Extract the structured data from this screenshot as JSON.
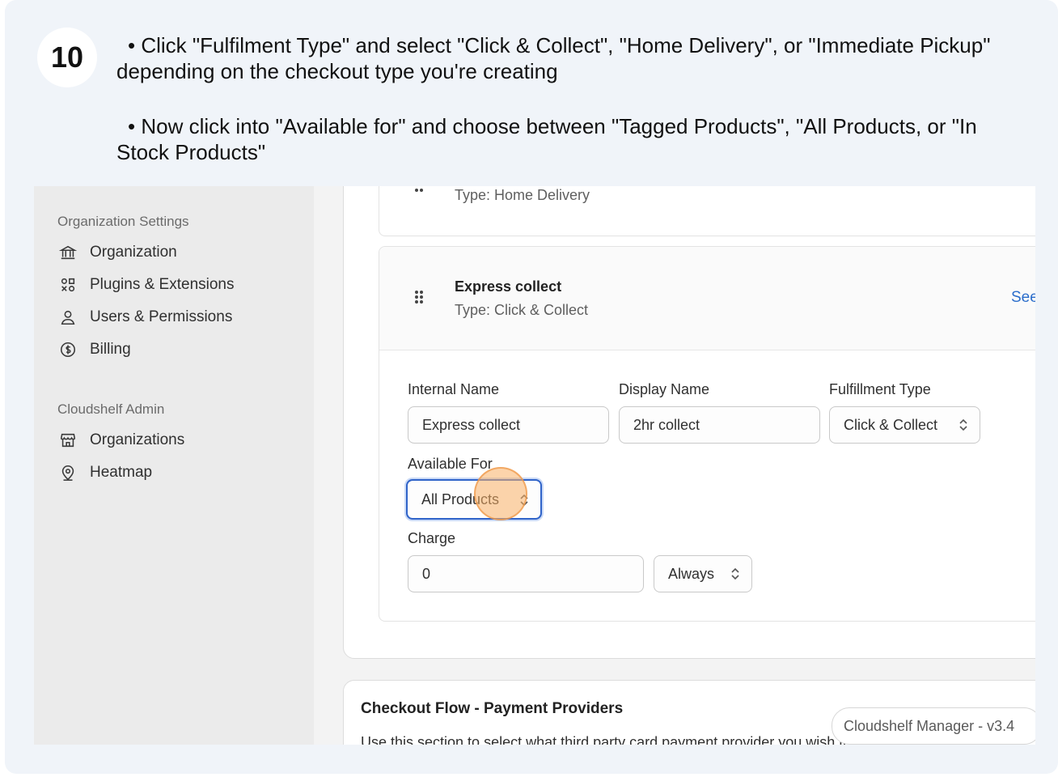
{
  "step": {
    "number": "10"
  },
  "instructions": {
    "line1": "• Click \"Fulfilment Type\" and select \"Click & Collect\", \"Home Delivery\", or \"Immediate Pickup\"",
    "line2": "depending on the checkout type you're creating",
    "line3": "• Now click into \"Available for\" and choose between \"Tagged Products\", \"All Products, or \"In",
    "line4": "Stock Products\""
  },
  "sidebar": {
    "section1": "Organization Settings",
    "items1": [
      {
        "label": "Organization",
        "icon": "bank-icon"
      },
      {
        "label": "Plugins & Extensions",
        "icon": "plugins-icon"
      },
      {
        "label": "Users & Permissions",
        "icon": "user-icon"
      },
      {
        "label": "Billing",
        "icon": "dollar-circle-icon"
      }
    ],
    "section2": "Cloudshelf Admin",
    "items2": [
      {
        "label": "Organizations",
        "icon": "store-icon"
      },
      {
        "label": "Heatmap",
        "icon": "location-pin-icon"
      }
    ]
  },
  "prev_method": {
    "type_text": "Type: Home Delivery"
  },
  "method": {
    "title": "Express collect",
    "type_text": "Type: Click & Collect",
    "see_link": "See"
  },
  "form": {
    "internal_name_label": "Internal Name",
    "internal_name_value": "Express collect",
    "display_name_label": "Display Name",
    "display_name_value": "2hr collect",
    "fulfillment_type_label": "Fulfillment Type",
    "fulfillment_type_value": "Click & Collect",
    "available_for_label": "Available For",
    "available_for_value": "All Products",
    "charge_label": "Charge",
    "charge_value": "0",
    "charge_frequency_value": "Always"
  },
  "payment_section": {
    "title": "Checkout Flow - Payment Providers",
    "description": "Use this section to select what third party card payment provider you wish to use"
  },
  "footer": {
    "version": "Cloudshelf Manager - v3.4"
  }
}
